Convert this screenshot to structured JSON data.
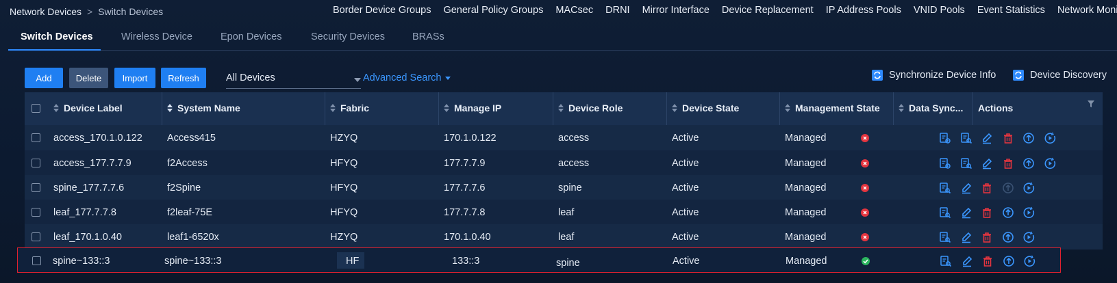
{
  "breadcrumb": {
    "root": "Network Devices",
    "separator": ">",
    "current": "Switch Devices"
  },
  "topnav": [
    "Border Device Groups",
    "General Policy Groups",
    "MACsec",
    "DRNI",
    "Mirror Interface",
    "Device Replacement",
    "IP Address Pools",
    "VNID Pools",
    "Event Statistics",
    "Network Monitoring"
  ],
  "tabs": [
    "Switch Devices",
    "Wireless Device",
    "Epon Devices",
    "Security Devices",
    "BRASs"
  ],
  "toolbar": {
    "add": "Add",
    "delete": "Delete",
    "import": "Import",
    "refresh": "Refresh",
    "filter_value": "All Devices",
    "advanced_search": "Advanced Search",
    "sync": "Synchronize Device Info",
    "discovery": "Device Discovery"
  },
  "columns": [
    "Device Label",
    "System Name",
    "Fabric",
    "Manage IP",
    "Device Role",
    "Device State",
    "Management State",
    "Data Sync...",
    "Actions"
  ],
  "rows": [
    {
      "label": "access_170.1.0.122",
      "system": "Access415",
      "fabric": "HZYQ",
      "ip": "170.1.0.122",
      "role": "access",
      "state": "Active",
      "mgmt": "Managed",
      "sync": "error"
    },
    {
      "label": "access_177.7.7.9",
      "system": "f2Access",
      "fabric": "HFYQ",
      "ip": "177.7.7.9",
      "role": "access",
      "state": "Active",
      "mgmt": "Managed",
      "sync": "error"
    },
    {
      "label": "spine_177.7.7.6",
      "system": "f2Spine",
      "fabric": "HFYQ",
      "ip": "177.7.7.6",
      "role": "spine",
      "state": "Active",
      "mgmt": "Managed",
      "sync": "error"
    },
    {
      "label": "leaf_177.7.7.8",
      "system": "f2leaf-75E",
      "fabric": "HFYQ",
      "ip": "177.7.7.8",
      "role": "leaf",
      "state": "Active",
      "mgmt": "Managed",
      "sync": "error"
    },
    {
      "label": "leaf_170.1.0.40",
      "system": "leaf1-6520x",
      "fabric": "HZYQ",
      "ip": "170.1.0.40",
      "role": "leaf",
      "state": "Active",
      "mgmt": "Managed",
      "sync": "error"
    },
    {
      "label": "spine~133::3",
      "system": "spine~133::3",
      "fabric": "HF",
      "ip": "133::3",
      "role": "spine",
      "state": "Active",
      "mgmt": "Managed",
      "sync": "ok"
    }
  ],
  "colors": {
    "accent": "#1f7ff2",
    "error": "#e4353f",
    "ok": "#2bb55e",
    "delete_icon": "#e4353f",
    "highlight_border": "#e0212f"
  }
}
